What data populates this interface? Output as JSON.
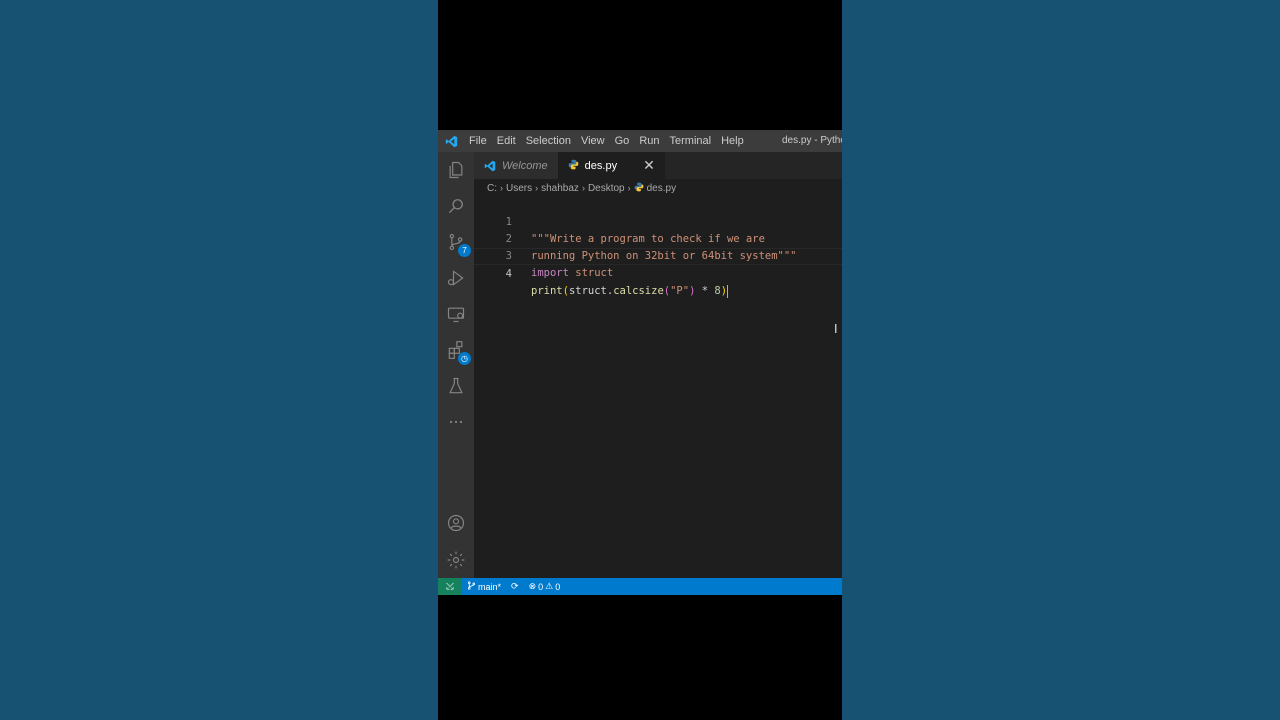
{
  "titlebar": {
    "menu": [
      "File",
      "Edit",
      "Selection",
      "View",
      "Go",
      "Run",
      "Terminal",
      "Help"
    ],
    "window_title": "des.py - Python"
  },
  "activity_bar": {
    "items": [
      "explorer-icon",
      "search-icon",
      "source-control-icon",
      "run-debug-icon",
      "remote-explorer-icon",
      "extensions-icon",
      "testing-icon",
      "more-icon"
    ],
    "source_control_badge": "7",
    "bottom": [
      "account-icon",
      "settings-gear-icon"
    ]
  },
  "tabs": [
    {
      "label": "Welcome",
      "active": false
    },
    {
      "label": "des.py",
      "active": true,
      "close": "✕"
    }
  ],
  "breadcrumb": [
    "C:",
    "Users",
    "shahbaz",
    "Desktop",
    "des.py"
  ],
  "editor": {
    "line_numbers": [
      "1",
      "2",
      "3",
      "4"
    ],
    "line1": "\"\"\"Write a program to check if we are",
    "line2": "running Python on 32bit or 64bit system\"\"\"",
    "line3_kw": "import",
    "line3_mod": " struct",
    "line4_fn": "print",
    "line4_open": "(",
    "line4_obj": "struct.",
    "line4_method": "calcsize",
    "line4_open2": "(",
    "line4_arg": "\"P\"",
    "line4_close2": ")",
    "line4_op": " * ",
    "line4_num": "8",
    "line4_close": ")"
  },
  "statusbar": {
    "branch": "main*",
    "errors": "0",
    "warnings": "0"
  },
  "colors": {
    "background": "#175272",
    "statusbar": "#007acc",
    "remote": "#16825d",
    "editor": "#1e1e1e"
  }
}
